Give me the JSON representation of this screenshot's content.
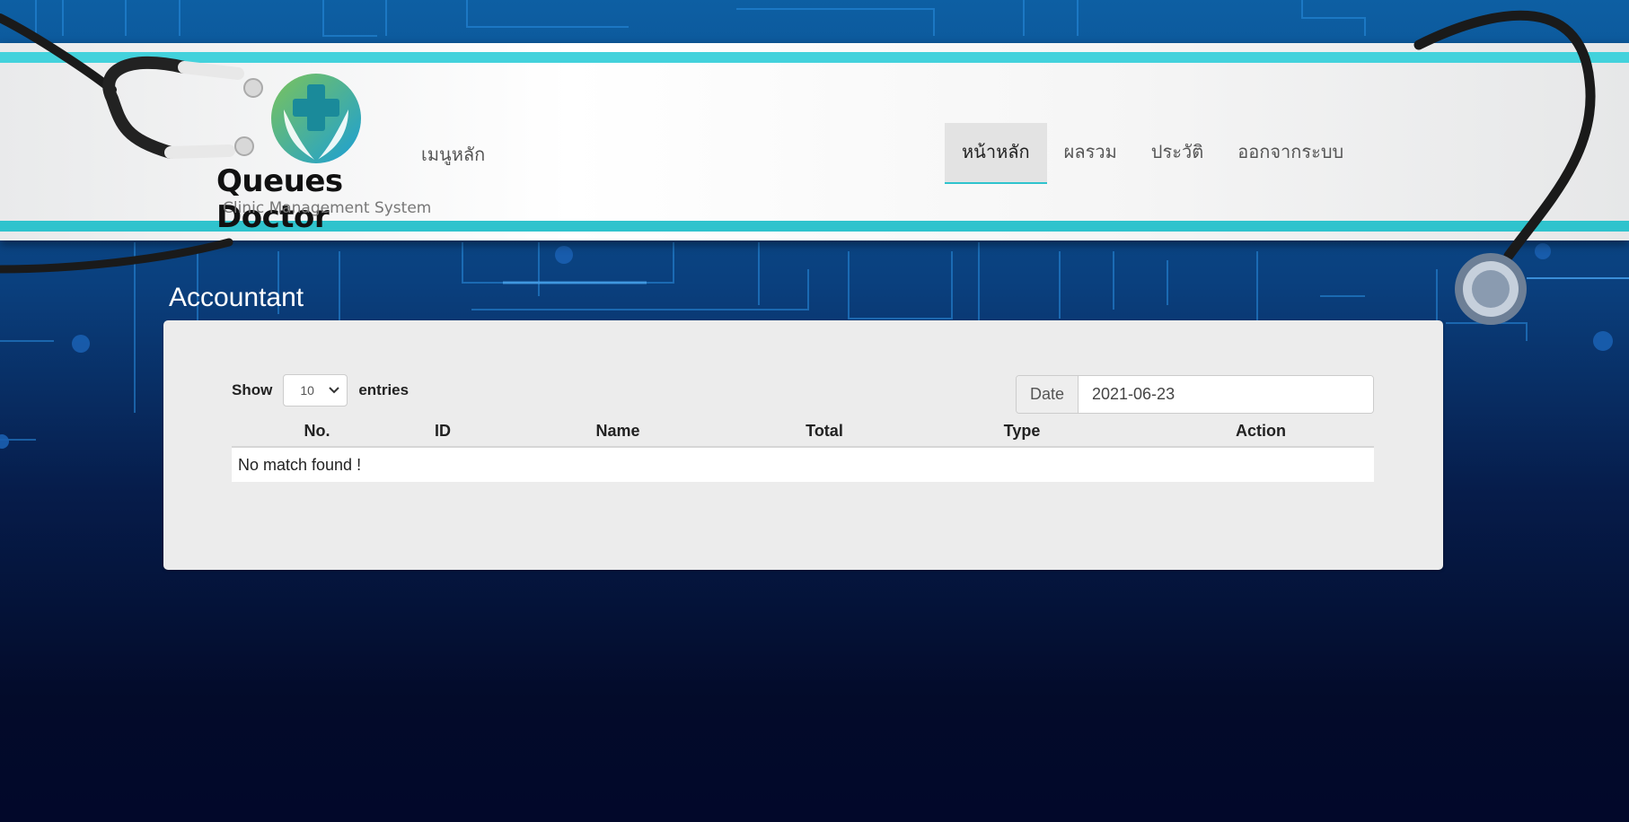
{
  "brand": {
    "name": "Queues Doctor",
    "tagline": "Clinic Management System"
  },
  "header": {
    "menu_title": "เมนูหลัก",
    "nav": [
      {
        "label": "หน้าหลัก",
        "active": true
      },
      {
        "label": "ผลรวม",
        "active": false
      },
      {
        "label": "ประวัติ",
        "active": false
      },
      {
        "label": "ออกจากระบบ",
        "active": false
      }
    ]
  },
  "page": {
    "title": "Accountant"
  },
  "table_controls": {
    "show_label": "Show",
    "page_size": "10",
    "entries_label": "entries",
    "date_label": "Date",
    "date_value": "2021-06-23"
  },
  "table": {
    "columns": [
      "No.",
      "ID",
      "Name",
      "Total",
      "Type",
      "Action"
    ],
    "empty_message": "No match found !"
  },
  "colors": {
    "accent": "#43d2dc",
    "panel": "#ececec"
  }
}
